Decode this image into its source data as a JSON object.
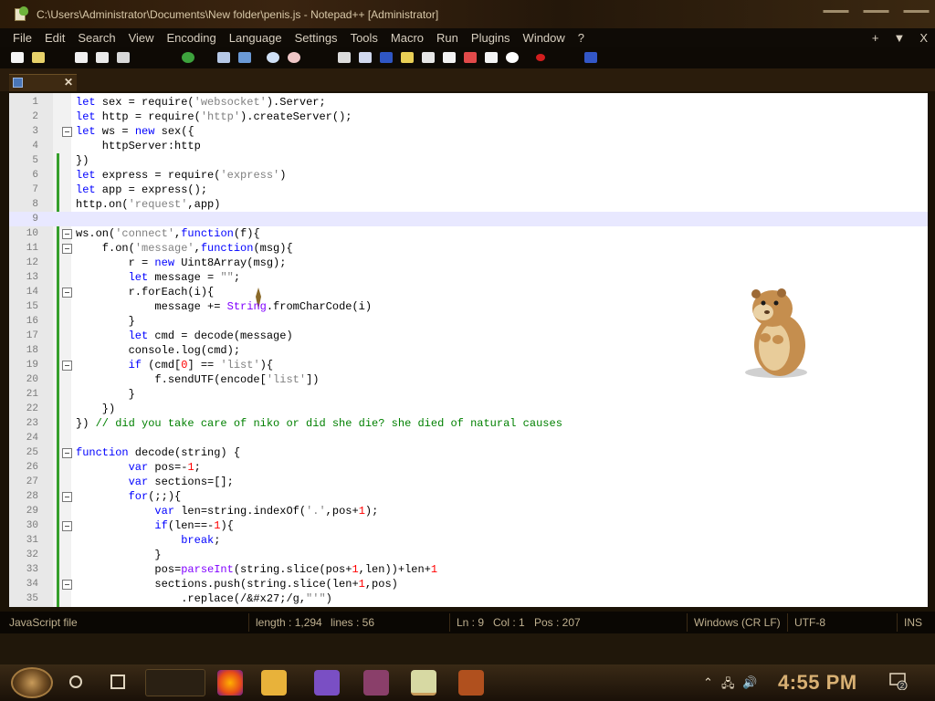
{
  "window": {
    "title": "C:\\Users\\Administrator\\Documents\\New folder\\penis.js - Notepad++ [Administrator]"
  },
  "menu": [
    "File",
    "Edit",
    "Search",
    "View",
    "Encoding",
    "Language",
    "Settings",
    "Tools",
    "Macro",
    "Run",
    "Plugins",
    "Window",
    "?"
  ],
  "menu_right": [
    "+",
    "▼",
    "X"
  ],
  "editor": {
    "current_line": 9,
    "lines": [
      {
        "n": "1",
        "code": "let sex = require('websocket').Server;"
      },
      {
        "n": "2",
        "code": "let http = require('http').createServer();"
      },
      {
        "n": "3",
        "code": "let ws = new sex({"
      },
      {
        "n": "4",
        "code": "    httpServer:http"
      },
      {
        "n": "5",
        "code": "})"
      },
      {
        "n": "6",
        "code": "let express = require('express')"
      },
      {
        "n": "7",
        "code": "let app = express();"
      },
      {
        "n": "8",
        "code": "http.on('request',app)"
      },
      {
        "n": "9",
        "code": ""
      },
      {
        "n": "10",
        "code": "ws.on('connect',function(f){"
      },
      {
        "n": "11",
        "code": "    f.on('message',function(msg){"
      },
      {
        "n": "12",
        "code": "        r = new Uint8Array(msg);"
      },
      {
        "n": "13",
        "code": "        let message = \"\";"
      },
      {
        "n": "14",
        "code": "        r.forEach(i){"
      },
      {
        "n": "15",
        "code": "            message += String.fromCharCode(i)"
      },
      {
        "n": "16",
        "code": "        }"
      },
      {
        "n": "17",
        "code": "        let cmd = decode(message)"
      },
      {
        "n": "18",
        "code": "        console.log(cmd);"
      },
      {
        "n": "19",
        "code": "        if (cmd[0] == 'list'){"
      },
      {
        "n": "20",
        "code": "            f.sendUTF(encode['list'])"
      },
      {
        "n": "21",
        "code": "        }"
      },
      {
        "n": "22",
        "code": "    })"
      },
      {
        "n": "23",
        "code": "}) // did you take care of niko or did she die? she died of natural causes"
      },
      {
        "n": "24",
        "code": ""
      },
      {
        "n": "25",
        "code": "function decode(string) {"
      },
      {
        "n": "26",
        "code": "        var pos=-1;"
      },
      {
        "n": "27",
        "code": "        var sections=[];"
      },
      {
        "n": "28",
        "code": "        for(;;){"
      },
      {
        "n": "29",
        "code": "            var len=string.indexOf('.',pos+1);"
      },
      {
        "n": "30",
        "code": "            if(len==-1){"
      },
      {
        "n": "31",
        "code": "                break;"
      },
      {
        "n": "32",
        "code": "            }"
      },
      {
        "n": "33",
        "code": "            pos=parseInt(string.slice(pos+1,len))+len+1"
      },
      {
        "n": "34",
        "code": "            sections.push(string.slice(len+1,pos)"
      },
      {
        "n": "35",
        "code": "                .replace(/&#x27;/g,\"'\")"
      }
    ]
  },
  "status": {
    "file_type": "JavaScript file",
    "length": "length : 1,294",
    "lines": "lines : 56",
    "ln": "Ln : 9",
    "col": "Col : 1",
    "pos": "Pos : 207",
    "eol": "Windows (CR LF)",
    "encoding": "UTF-8",
    "mode": "INS"
  },
  "taskbar": {
    "clock": "4:55 PM",
    "notification_count": "2"
  },
  "colors": {
    "keyword": "#0000ff",
    "string": "#808080",
    "number": "#ff0000",
    "comment": "#008000",
    "clock": "#d8b073"
  }
}
